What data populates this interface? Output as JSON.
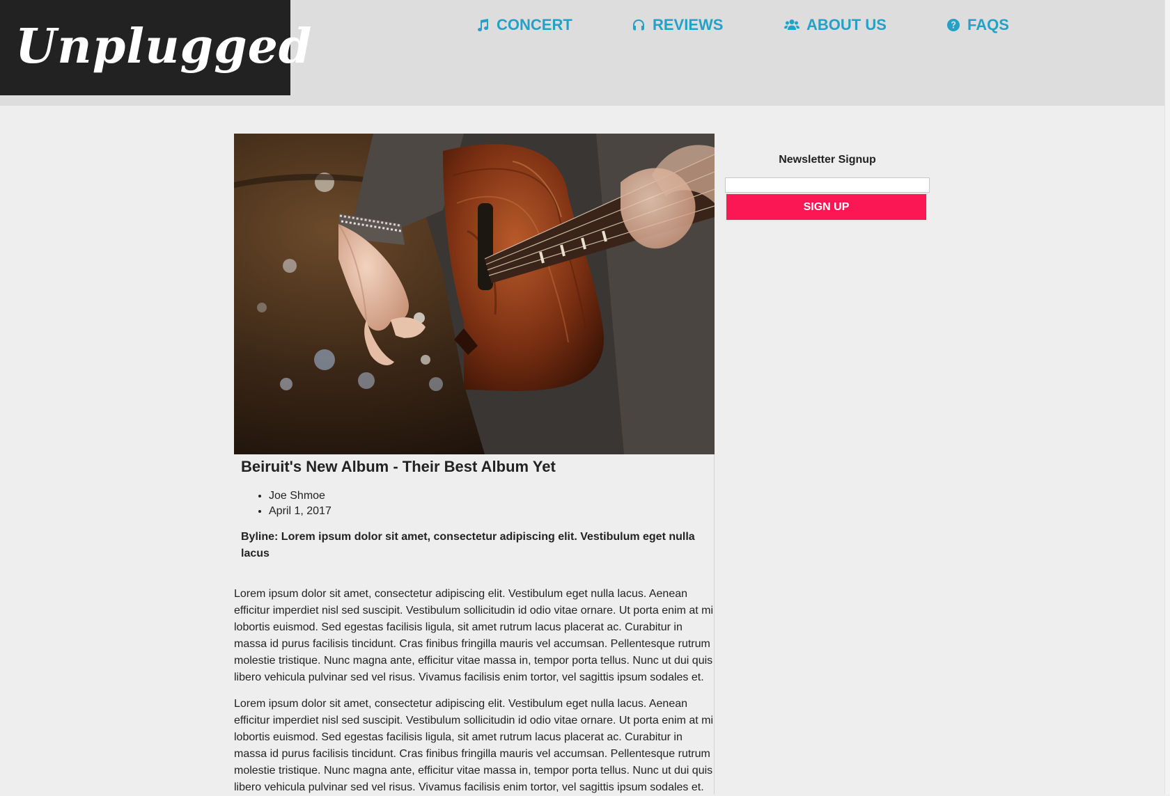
{
  "site": {
    "logo": "Unplugged"
  },
  "nav": [
    {
      "label": "CONCERT",
      "icon": "music-note-icon"
    },
    {
      "label": "REVIEWS",
      "icon": "headphones-icon"
    },
    {
      "label": "ABOUT US",
      "icon": "users-icon"
    },
    {
      "label": "FAQS",
      "icon": "question-circle-icon"
    }
  ],
  "colors": {
    "nav_link": "#23a1c7",
    "logo_bg": "#222222",
    "header_bg": "#dddddd",
    "page_bg": "#eeeeee",
    "signup_button": "#fb1654"
  },
  "article": {
    "image_alt": "guitarist-photo",
    "title": "Beiruit's New Album - Their Best Album Yet",
    "author": "Joe Shmoe",
    "date": "April 1, 2017",
    "byline": "Byline: Lorem ipsum dolor sit amet, consectetur adipiscing elit. Vestibulum eget nulla lacus",
    "paragraphs": [
      "Lorem ipsum dolor sit amet, consectetur adipiscing elit. Vestibulum eget nulla lacus. Aenean efficitur imperdiet nisl sed suscipit. Vestibulum sollicitudin id odio vitae ornare. Ut porta enim at mi lobortis euismod. Sed egestas facilisis ligula, sit amet rutrum lacus placerat ac. Curabitur in massa id purus facilisis tincidunt. Cras finibus fringilla mauris vel accumsan. Pellentesque rutrum molestie tristique. Nunc magna ante, efficitur vitae massa in, tempor porta tellus. Nunc ut dui quis libero vehicula pulvinar sed vel risus. Vivamus facilisis enim tortor, vel sagittis ipsum sodales et.",
      "Lorem ipsum dolor sit amet, consectetur adipiscing elit. Vestibulum eget nulla lacus. Aenean efficitur imperdiet nisl sed suscipit. Vestibulum sollicitudin id odio vitae ornare. Ut porta enim at mi lobortis euismod. Sed egestas facilisis ligula, sit amet rutrum lacus placerat ac. Curabitur in massa id purus facilisis tincidunt. Cras finibus fringilla mauris vel accumsan. Pellentesque rutrum molestie tristique. Nunc magna ante, efficitur vitae massa in, tempor porta tellus. Nunc ut dui quis libero vehicula pulvinar sed vel risus. Vivamus facilisis enim tortor, vel sagittis ipsum sodales et."
    ]
  },
  "newsletter": {
    "title": "Newsletter Signup",
    "input_value": "",
    "button_label": "SIGN UP"
  }
}
